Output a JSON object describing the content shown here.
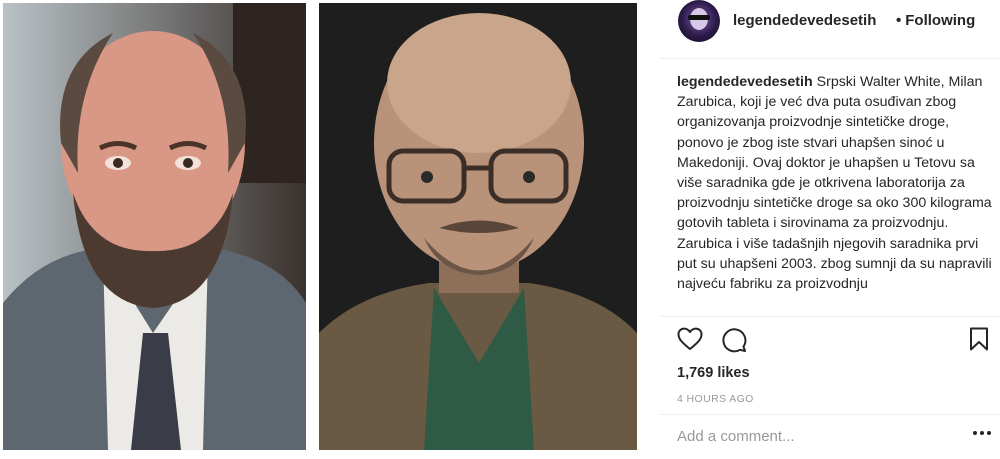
{
  "post": {
    "username": "legendedevedesetih",
    "separator": "•",
    "follow_status": "Following",
    "caption_user": "legendedevedesetih",
    "caption_text": "Srpski Walter White, Milan Zarubica, koji je već dva puta osuđivan zbog organizovanja proizvodnje sintetičke droge, ponovo je zbog iste stvari uhapšen sinoć u Makedoniji. Ovaj doktor je uhapšen u Tetovu sa više saradnika gde je otkrivena laboratorija za proizvodnju sintetičke droge sa oko 300 kilograma gotovih tableta i sirovinama za proizvodnju. Zarubica i više tadašnjih njegovih saradnika prvi put su uhapšeni 2003. zbog sumnji da su napravili najveću fabriku za proizvodnju",
    "likes": "1,769 likes",
    "time_ago": "4 HOURS AGO",
    "comment_placeholder": "Add a comment..."
  },
  "icons": {
    "like": "heart-outline-icon",
    "comment": "speech-bubble-icon",
    "save": "bookmark-icon",
    "more": "ellipsis-icon"
  },
  "colors": {
    "text": "#262626",
    "muted": "#999999",
    "divider": "#efefef"
  }
}
